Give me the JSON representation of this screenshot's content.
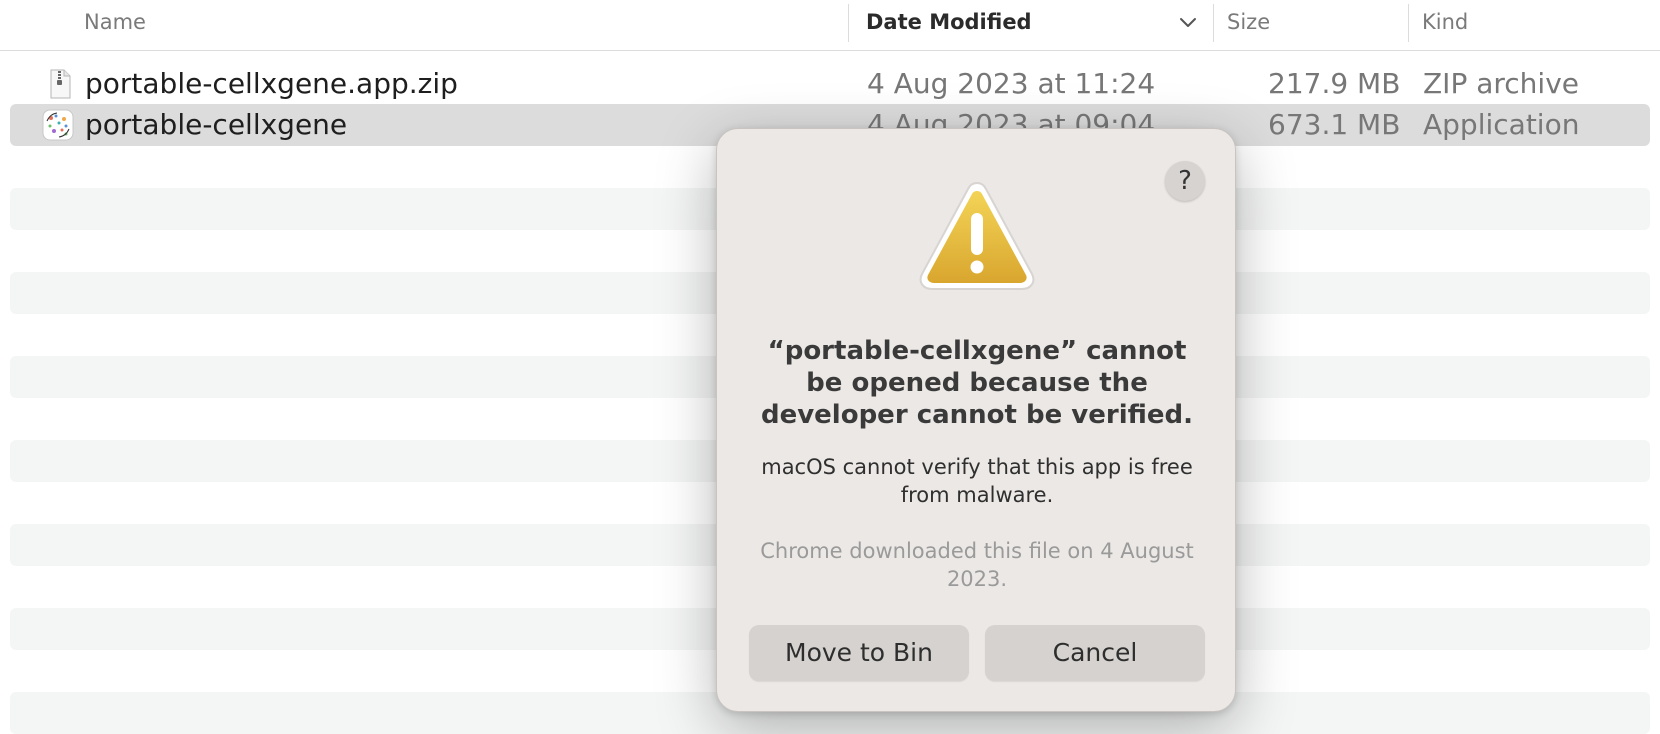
{
  "columns": {
    "name": "Name",
    "date_modified": "Date Modified",
    "size": "Size",
    "kind": "Kind"
  },
  "files": [
    {
      "name": "portable-cellxgene.app.zip",
      "date": "4 Aug 2023 at 11:24",
      "size": "217.9 MB",
      "kind": "ZIP archive",
      "icon": "zip-file-icon",
      "selected": false
    },
    {
      "name": "portable-cellxgene",
      "date": "4 Aug 2023 at 09:04",
      "size": "673.1 MB",
      "kind": "Application",
      "icon": "app-icon",
      "selected": true
    }
  ],
  "dialog": {
    "help_label": "?",
    "icon": "warning-triangle-icon",
    "title": "“portable-cellxgene” cannot be opened because the developer cannot be verified.",
    "message": "macOS cannot verify that this app is free from malware.",
    "note": "Chrome downloaded this file on 4 August 2023.",
    "primary_button": "Move to Bin",
    "cancel_button": "Cancel"
  },
  "colors": {
    "selection": "#dcdcdc",
    "stripe": "#f4f5f5",
    "dialog_bg": "#ece8e6",
    "warning_yellow": "#e8be3c"
  }
}
